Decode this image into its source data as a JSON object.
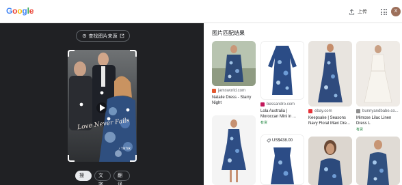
{
  "app": {
    "logo_letters": [
      {
        "ch": "G",
        "color": "#4285F4"
      },
      {
        "ch": "o",
        "color": "#EA4335"
      },
      {
        "ch": "o",
        "color": "#FBBC05"
      },
      {
        "ch": "g",
        "color": "#4285F4"
      },
      {
        "ch": "l",
        "color": "#34A853"
      },
      {
        "ch": "e",
        "color": "#EA4335"
      }
    ],
    "upload_label": "上传",
    "avatar_letter": "X"
  },
  "left": {
    "find_source_label": "查找图片来源",
    "tabs": [
      {
        "label": "搜索",
        "active": true
      },
      {
        "label": "文字",
        "active": false
      },
      {
        "label": "翻译",
        "active": false
      }
    ]
  },
  "results": {
    "title": "图片匹配结果",
    "cards": [
      {
        "site": "jamsworld.com",
        "title": "Natalie Dress - Starry Night",
        "favicon_color": "#e4572e"
      },
      {
        "site": "bessandro.com",
        "title": "Lola Australia | Moroccan Mini in ...",
        "stock": "有货",
        "favicon_color": "#c2185b"
      },
      {
        "site": "ebay.com",
        "title": "Keepsake | Seasons Navy Floral Maxi Dre...",
        "favicon_color": "#e53238"
      },
      {
        "site": "bunnyandbabe.co...",
        "title": "Mimose Lilac Linen Dress L",
        "stock": "有货",
        "favicon_color": "#8e8e8e"
      },
      {
        "price": "US$438.00"
      },
      {},
      {},
      {},
      {}
    ]
  },
  "colors": {
    "left_bg": "#202124",
    "accent_green": "#188038"
  }
}
